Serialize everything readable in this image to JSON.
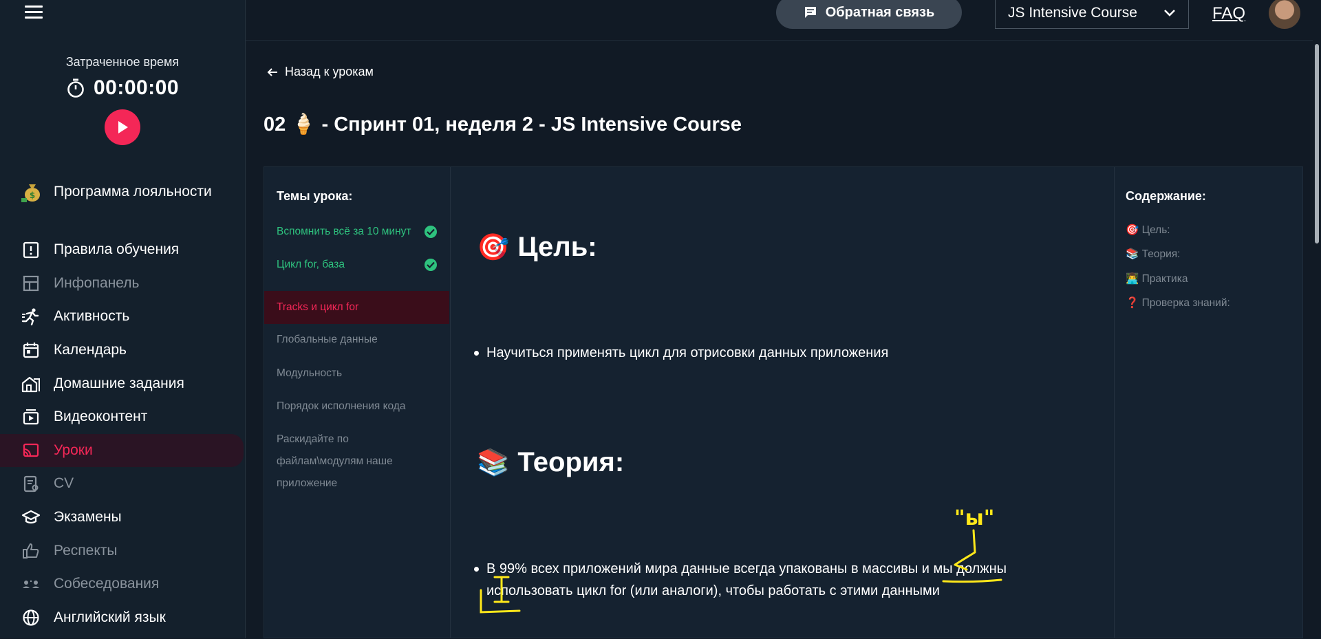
{
  "sidebar": {
    "timer_label": "Затраченное время",
    "timer_value": "00:00:00",
    "loyalty_label": "Программа лояльности",
    "items": [
      {
        "label": "Правила обучения"
      },
      {
        "label": "Инфопанель"
      },
      {
        "label": "Активность"
      },
      {
        "label": "Календарь"
      },
      {
        "label": "Домашние задания"
      },
      {
        "label": "Видеоконтент"
      },
      {
        "label": "Уроки"
      },
      {
        "label": "CV"
      },
      {
        "label": "Экзамены"
      },
      {
        "label": "Респекты"
      },
      {
        "label": "Собеседования"
      },
      {
        "label": "Английский язык"
      }
    ]
  },
  "header": {
    "feedback_label": "Обратная связь",
    "course_selected": "JS Intensive Course",
    "faq_label": "FAQ"
  },
  "main": {
    "back_label": "Назад к урокам",
    "lesson_title": "02 🍦 - Спринт 01, неделя 2 - JS Intensive Course"
  },
  "topics": {
    "title": "Темы урока:",
    "items": [
      {
        "label": "Вспомнить всё за 10 минут"
      },
      {
        "label": "Цикл for, база"
      },
      {
        "label": "Tracks и цикл for"
      },
      {
        "label": "Глобальные данные"
      },
      {
        "label": "Модульность"
      },
      {
        "label": "Порядок исполнения кода"
      },
      {
        "label": "Раскидайте по файлам\\модулям наше приложение"
      }
    ]
  },
  "content": {
    "goal_icon": "🎯",
    "goal_heading": "Цель:",
    "goal_bullet": "Научиться применять цикл для отрисовки данных приложения",
    "theory_icon": "📚",
    "theory_heading": "Теория:",
    "theory_bullet": "В 99% всех приложений мира данные всегда упакованы в массивы и мы должны использовать цикл for (или аналоги), чтобы работать с этими данными",
    "annotation_text": "\"ы\""
  },
  "toc": {
    "title": "Содержание:",
    "items": [
      {
        "label": "🎯 Цель:"
      },
      {
        "label": "📚 Теория:"
      },
      {
        "label": "👨‍💻 Практика"
      },
      {
        "label": "❓ Проверка знаний:"
      }
    ]
  },
  "colors": {
    "accent": "#f42757",
    "success": "#2ec27e",
    "background": "#111a25",
    "annotation": "#ffe81a"
  }
}
